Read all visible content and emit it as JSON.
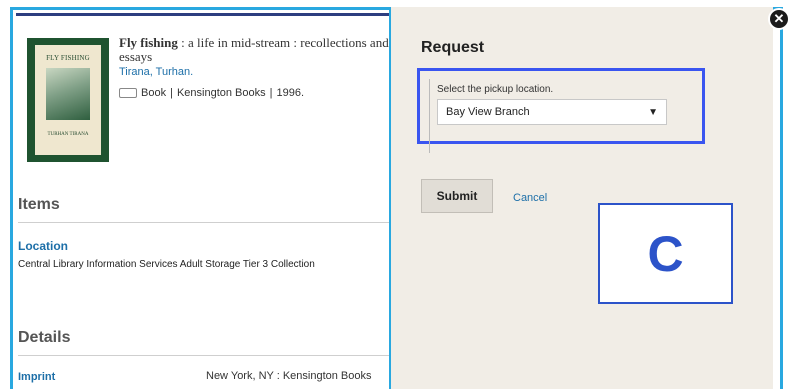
{
  "book": {
    "cover_title": "FLY FISHING",
    "cover_author": "TURHAN TIRANA",
    "title_bold": "Fly fishing",
    "title_rest": " : a life in mid-stream : recollections and essays",
    "author": "Tirana, Turhan.",
    "format": "Book",
    "publisher": "Kensington Books",
    "year": "1996.",
    "separator": "|"
  },
  "items": {
    "heading": "Items",
    "location_label": "Location",
    "location_value": "Central Library Information Services Adult Storage Tier 3 Collection"
  },
  "details": {
    "heading": "Details",
    "imprint_label": "Imprint",
    "imprint_value": "New York, NY : Kensington Books"
  },
  "modal": {
    "title": "Request",
    "select_label": "Select the pickup location.",
    "selected_branch": "Bay View Branch",
    "submit_label": "Submit",
    "cancel_label": "Cancel",
    "close_glyph": "✕"
  },
  "annotation": {
    "letter": "C",
    "highlight_color": "#3a55f0",
    "letter_color": "#2c53c9"
  },
  "colors": {
    "frame": "#29a8e0",
    "link": "#1d6fa8",
    "modal_bg": "#f1ede6"
  }
}
